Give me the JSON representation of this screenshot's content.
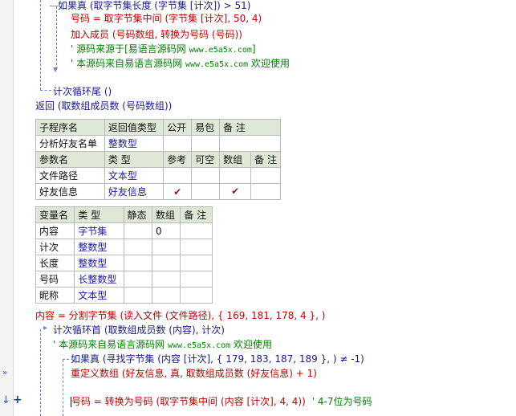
{
  "code_top": {
    "line1": "如果真 (取字节集长度 (字节集 [计次]) > 51)",
    "line2": "号码 = 取字节集中间 (字节集 [计次], 50, 4)",
    "line3": "加入成员 (号码数组, 转换为号码 (号码))",
    "line4_prefix": "' 源码来源于[易语言源码网 ",
    "line4_url": "www.e5a5x.com",
    "line4_suffix": "]",
    "line5_prefix": "' 本源码来自易语言源码网 ",
    "line5_url": "www.e5a5x.com",
    "line5_suffix": "  欢迎使用",
    "loop_end": "计次循环尾 ()",
    "return_line": "返回 (取数组成员数 (号码数组))"
  },
  "sub_table": {
    "headers": [
      "子程序名",
      "返回值类型",
      "公开",
      "易包",
      "备 注"
    ],
    "row": [
      "分析好友名单",
      "整数型",
      "",
      "",
      ""
    ]
  },
  "param_table": {
    "headers": [
      "参数名",
      "类 型",
      "参考",
      "可空",
      "数组",
      "备 注"
    ],
    "rows": [
      [
        "文件路径",
        "文本型",
        "",
        "",
        "",
        ""
      ],
      [
        "好友信息",
        "好友信息",
        "✔",
        "",
        "✔",
        ""
      ]
    ]
  },
  "var_table": {
    "headers": [
      "变量名",
      "类 型",
      "静态",
      "数组",
      "备 注"
    ],
    "rows": [
      [
        "内容",
        "字节集",
        "",
        "0",
        ""
      ],
      [
        "计次",
        "整数型",
        "",
        "",
        ""
      ],
      [
        "长度",
        "整数型",
        "",
        "",
        ""
      ],
      [
        "号码",
        "长整数型",
        "",
        "",
        ""
      ],
      [
        "昵称",
        "文本型",
        "",
        "",
        ""
      ]
    ]
  },
  "code_bottom": {
    "line1": "内容 = 分割字节集 (读入文件 (文件路径), { 169, 181, 178, 4 }, )",
    "line2": "计次循环首 (取数组成员数 (内容), 计次)",
    "line3_prefix": "' 本源码来自易语言源码网 ",
    "line3_url": "www.e5a5x.com",
    "line3_suffix": "  欢迎使用",
    "line4": "如果真 (寻找字节集 (内容 [计次], { 179, 183, 187, 189 }, ) ≠ -1)",
    "line5": "重定义数组 (好友信息, 真, 取数组成员数 (好友信息) + 1)",
    "line6_a": "号码 = 转换为号码 (取字节集中间 (内容 [计次], 4, 4))",
    "line6_comment": "' 4-7位为号码"
  },
  "gutter": {
    "step_marker": "»",
    "arrow_marker": "↓",
    "plus_marker": "+"
  }
}
